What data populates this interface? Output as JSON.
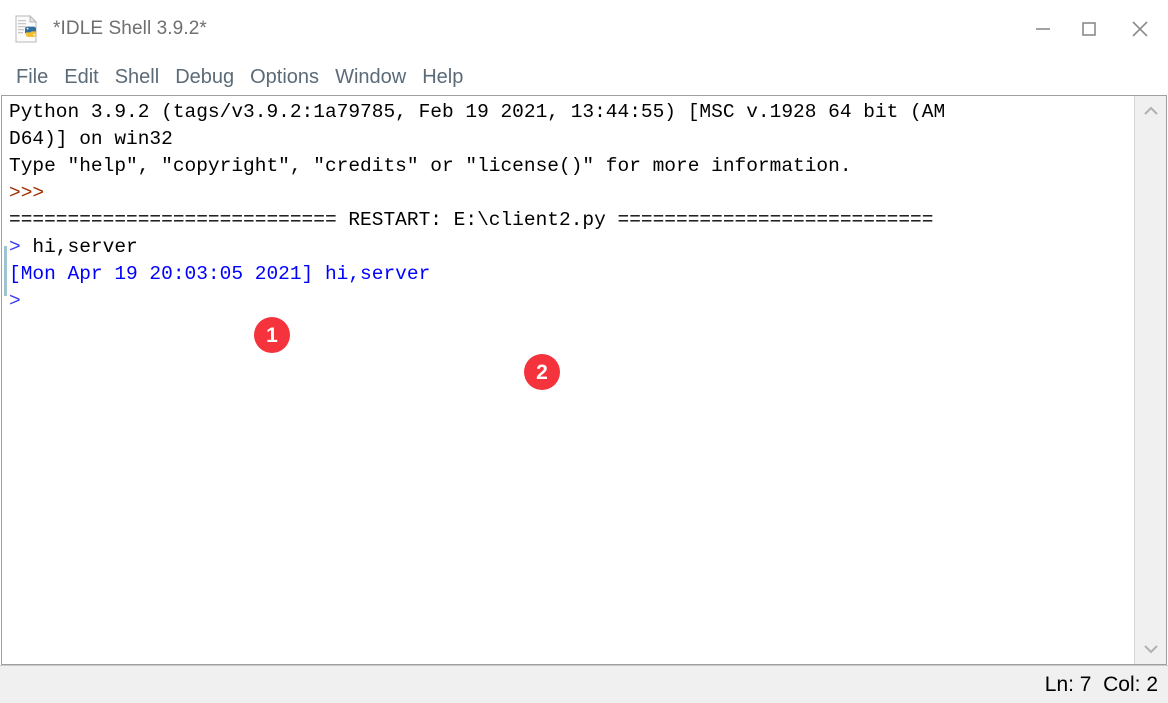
{
  "window": {
    "title": "*IDLE Shell 3.9.2*",
    "icon": "python-file-icon",
    "controls": [
      {
        "name": "minimize-button",
        "glyph": "minimize-icon"
      },
      {
        "name": "maximize-button",
        "glyph": "maximize-icon"
      },
      {
        "name": "close-button",
        "glyph": "close-icon"
      }
    ]
  },
  "menubar": {
    "items": [
      {
        "label": "File"
      },
      {
        "label": "Edit"
      },
      {
        "label": "Shell"
      },
      {
        "label": "Debug"
      },
      {
        "label": "Options"
      },
      {
        "label": "Window"
      },
      {
        "label": "Help"
      }
    ]
  },
  "console": {
    "lines": [
      {
        "segments": [
          {
            "text": "Python 3.9.2 (tags/v3.9.2:1a79785, Feb 19 2021, 13:44:55) [MSC v.1928 64 bit (AM",
            "color": "black"
          }
        ]
      },
      {
        "segments": [
          {
            "text": "D64)] on win32",
            "color": "black"
          }
        ]
      },
      {
        "segments": [
          {
            "text": "Type \"help\", \"copyright\", \"credits\" or \"license()\" for more information.",
            "color": "black"
          }
        ]
      },
      {
        "segments": [
          {
            "text": ">>>",
            "color": "prompt"
          }
        ]
      },
      {
        "segments": [
          {
            "text": "============================ RESTART: E:\\client2.py ===========================",
            "color": "black"
          }
        ]
      },
      {
        "segments": [
          {
            "text": "> ",
            "color": "stdin"
          },
          {
            "text": "hi,server",
            "color": "black"
          }
        ]
      },
      {
        "segments": [
          {
            "text": "[Mon Apr 19 20:03:05 2021] hi,server",
            "color": "blue"
          }
        ]
      },
      {
        "segments": [
          {
            "text": ">",
            "color": "stdin"
          }
        ]
      }
    ]
  },
  "scrollbar": {
    "up_label": "scroll-up",
    "down_label": "scroll-down"
  },
  "statusbar": {
    "position": "Ln: 7  Col: 2"
  },
  "annotations": [
    {
      "id": "1",
      "label": "1"
    },
    {
      "id": "2",
      "label": "2"
    }
  ],
  "colors": {
    "badge": "#f4333d",
    "output_blue": "#0000ff",
    "prompt": "#a03000",
    "stdin": "#3a3af0",
    "menu_text": "#5b6b78",
    "title_text": "#6f6f6f",
    "statusbar_bg": "#f0f0f0"
  }
}
